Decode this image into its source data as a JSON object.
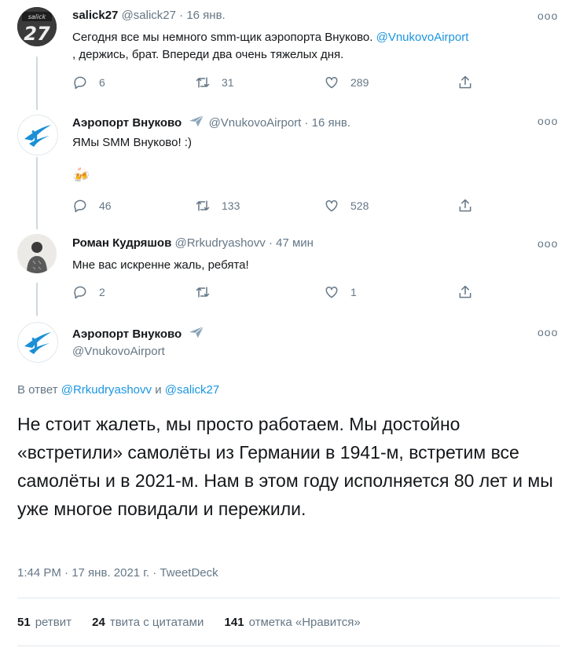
{
  "tweets": [
    {
      "name": "salick27",
      "handle": "@salick27",
      "time": "· 16 янв.",
      "avatar_text": "salick 27",
      "text_pre": "Сегодня все мы немного smm-щик аэропорта Внуково. ",
      "text_link": "@VnukovoAirport",
      "text_post": ", держись, брат. Впереди два очень тяжелых дня.",
      "replies": "6",
      "retweets": "31",
      "likes": "289"
    },
    {
      "name": "Аэропорт Внуково",
      "handle": "@VnukovoAirport",
      "time": "· 16 янв.",
      "text": "ЯМы SMM Внуково! :)",
      "emoji": "🍻",
      "replies": "46",
      "retweets": "133",
      "likes": "528"
    },
    {
      "name": "Роман Кудряшов",
      "handle": "@Rrkudryashovv",
      "time": "· 47 мин",
      "text": "Мне вас искренне жаль, ребята!",
      "replies": "2",
      "retweets": "",
      "likes": "1"
    }
  ],
  "main": {
    "name": "Аэропорт Внуково",
    "handle": "@VnukovoAirport",
    "reply_prefix": "В ответ",
    "reply_to_1": "@Rrkudryashovv",
    "reply_and": "и",
    "reply_to_2": "@salick27",
    "text": "Не стоит жалеть, мы просто работаем. Мы достойно «встретили» самолёты из Германии в 1941-м, встретим все самолёты и в 2021-м. Нам в этом году исполняется 80 лет и мы уже многое повидали и пережили.",
    "timestamp": "1:44 PM · 17 янв. 2021 г. · TweetDeck",
    "retweets_count": "51",
    "retweets_label": "ретвит",
    "quotes_count": "24",
    "quotes_label": "твита с цитатами",
    "likes_count": "141",
    "likes_label": "отметка «Нравится»"
  },
  "more_glyph": "ooo",
  "colors": {
    "link": "#1b95e0",
    "muted": "#657786",
    "brand_blue": "#1a8fd6"
  }
}
